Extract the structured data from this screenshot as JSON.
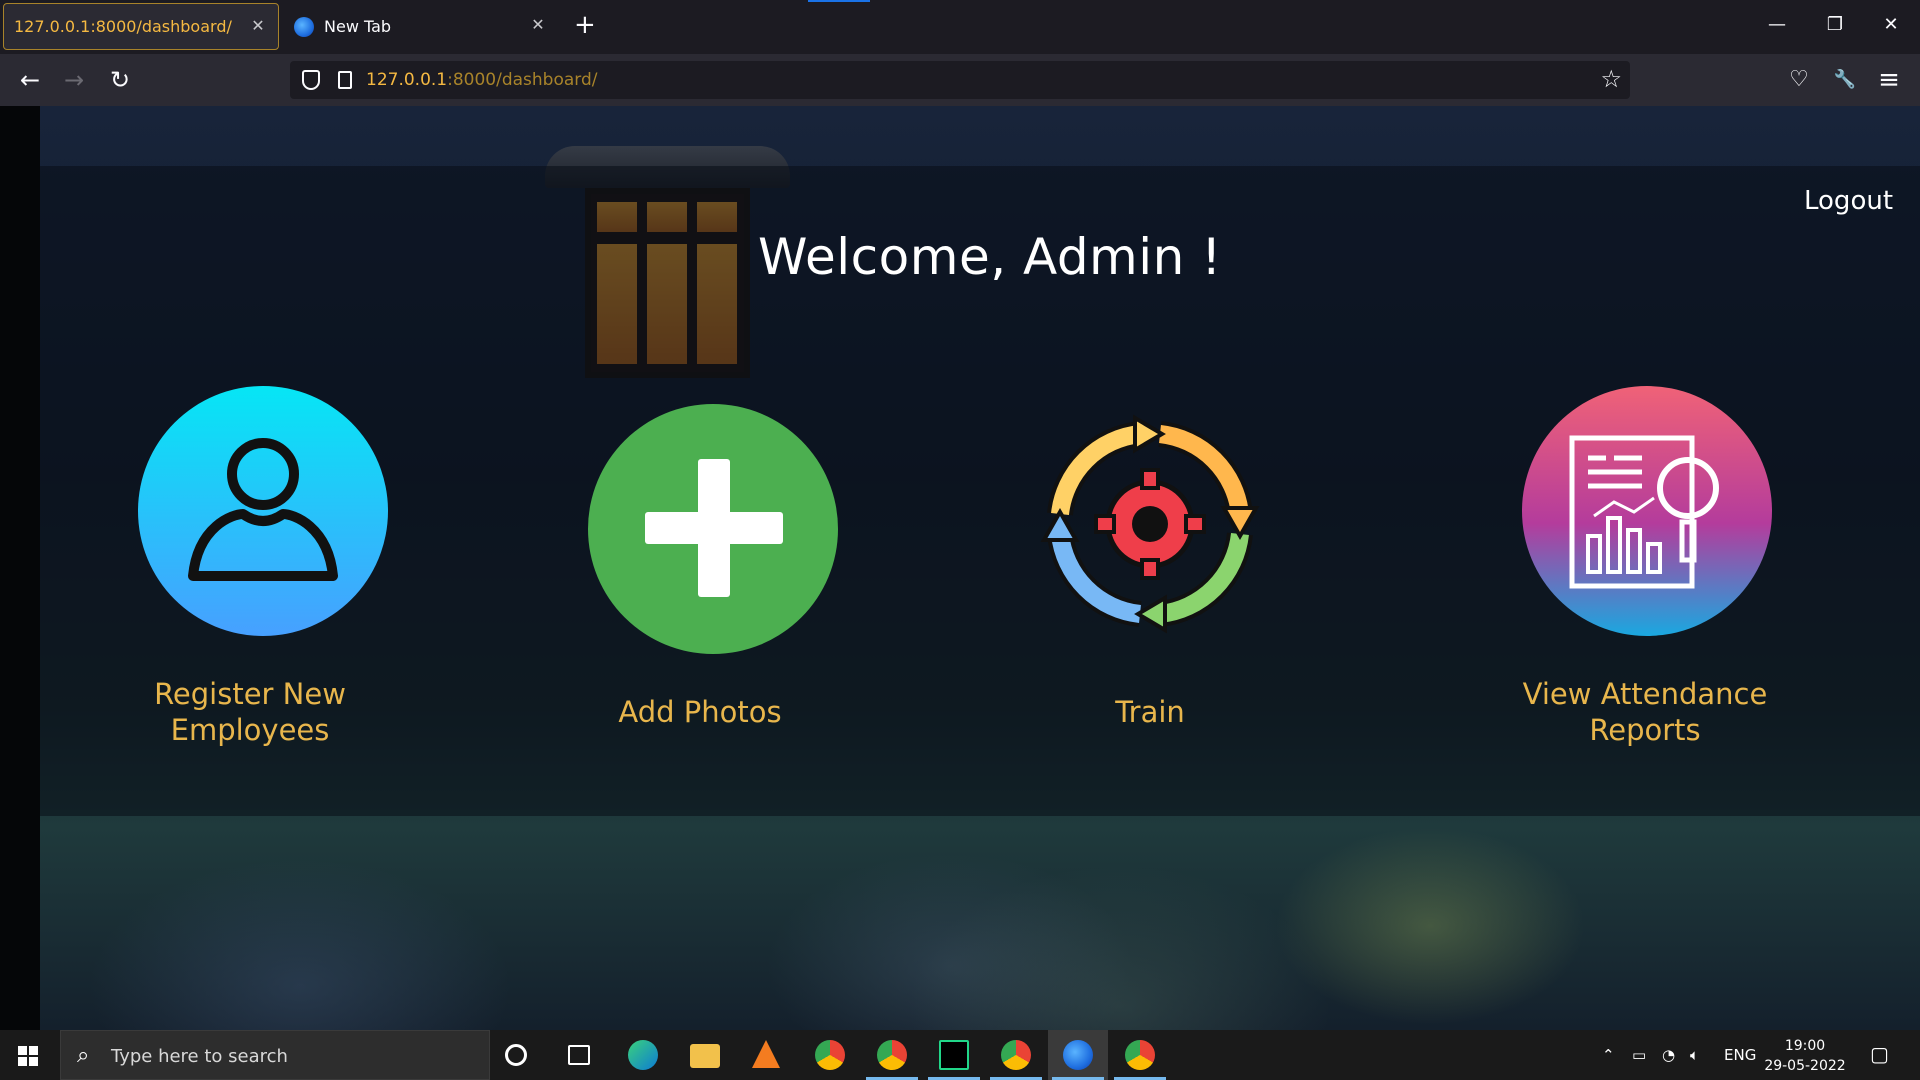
{
  "browser": {
    "tabs": [
      {
        "title": "127.0.0.1:8000/dashboard/",
        "active": true
      },
      {
        "title": "New Tab",
        "active": false
      }
    ],
    "new_tab": "+",
    "url_host": "127.0.0.1",
    "url_rest": ":8000/dashboard/",
    "window_controls": {
      "minimize": "—",
      "restore": "❐",
      "close": "✕"
    },
    "nav": {
      "back": "←",
      "forward": "→",
      "reload": "↻"
    },
    "toolbar": {
      "bookmark": "☆",
      "pocket": "♡",
      "tools": "🔧",
      "menu": "≡"
    }
  },
  "page": {
    "logout_label": "Logout",
    "welcome": "Welcome, Admin !",
    "actions": [
      {
        "line1": "Register New",
        "line2": "Employees"
      },
      {
        "line1": "Add Photos"
      },
      {
        "line1": "Train"
      },
      {
        "line1": "View Attendance",
        "line2": "Reports"
      }
    ]
  },
  "taskbar": {
    "search_placeholder": "Type here to search",
    "language": "ENG",
    "time": "19:00",
    "date": "29-05-2022"
  },
  "colors": {
    "accent_label": "#e8b64c",
    "url_accent": "#f5b942",
    "register_circle": [
      "#06e6f5",
      "#47a0ff"
    ],
    "add_circle": "#4caf50",
    "reports_circle": [
      "#f06277",
      "#b43c9c",
      "#1aa8e0"
    ]
  }
}
